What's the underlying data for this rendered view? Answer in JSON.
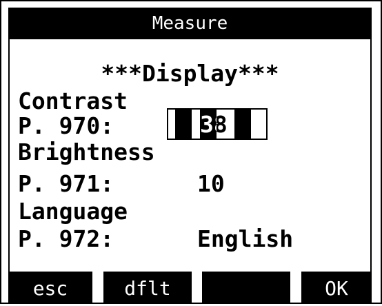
{
  "window": {
    "title": "Measure"
  },
  "screen": {
    "heading": "***Display***",
    "params": [
      {
        "name": "Contrast",
        "id_label": "P. 970:",
        "value": "38",
        "level_fraction": 0.38
      },
      {
        "name": "Brightness",
        "id_label": "P. 971:",
        "value": "10"
      },
      {
        "name": "Language",
        "id_label": "P. 972:",
        "value": "English"
      }
    ]
  },
  "softkeys": [
    {
      "label": "esc"
    },
    {
      "label": "dflt"
    },
    {
      "label": ""
    },
    {
      "label": "OK"
    }
  ],
  "colors": {
    "foreground": "#000000",
    "background": "#ffffff"
  }
}
